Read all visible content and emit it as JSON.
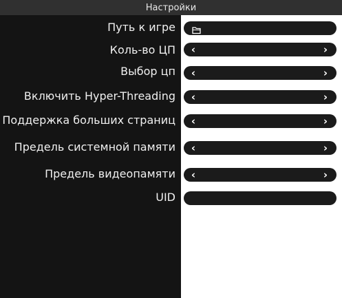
{
  "window": {
    "title": "Настройки"
  },
  "settings": {
    "game_path": {
      "label": "Путь к игре",
      "icon": "folder-icon",
      "value": ""
    },
    "cpu_count": {
      "label": "Коль-во ЦП"
    },
    "cpu_choice": {
      "label": "Выбор цп"
    },
    "hyper_threading": {
      "label": "Включить Hyper-Threading"
    },
    "large_pages": {
      "label": "Поддержка больших страниц"
    },
    "system_memory_limit": {
      "label": "Предель системной памяти"
    },
    "video_memory_limit": {
      "label": "Предель видеопамяти"
    },
    "uid": {
      "label": "UID",
      "value": ""
    }
  },
  "icons": {
    "prev": "‹",
    "next": "›"
  },
  "colors": {
    "panel_background": "#141414",
    "control_background": "#1b1b1b",
    "title_bar": "#303030",
    "content_background": "#ffffff",
    "text": "#f0f0f0"
  }
}
